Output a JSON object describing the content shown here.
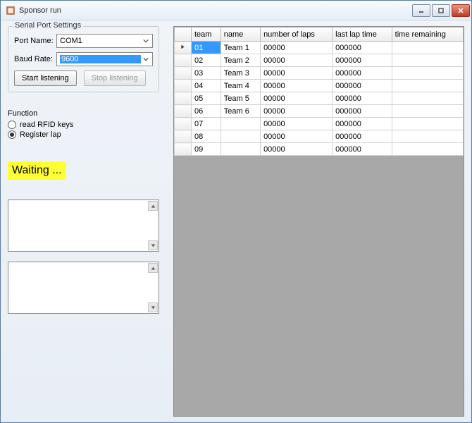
{
  "window": {
    "title": "Sponsor run"
  },
  "serial": {
    "legend": "Serial Port Settings",
    "port_label": "Port Name:",
    "port_value": "COM1",
    "baud_label": "Baud Rate:",
    "baud_value": "9600"
  },
  "buttons": {
    "start": "Start listening",
    "stop": "Stop listening"
  },
  "function": {
    "legend": "Function",
    "opt1": "read RFID keys",
    "opt2": "Register lap"
  },
  "status": "Waiting ...",
  "grid": {
    "headers": {
      "team": "team",
      "name": "name",
      "laps": "number of laps",
      "last": "last lap time",
      "remain": "time remaining"
    },
    "rows": [
      {
        "team": "01",
        "name": "Team 1",
        "laps": "00000",
        "last": "000000",
        "remain": ""
      },
      {
        "team": "02",
        "name": "Team 2",
        "laps": "00000",
        "last": "000000",
        "remain": ""
      },
      {
        "team": "03",
        "name": "Team 3",
        "laps": "00000",
        "last": "000000",
        "remain": ""
      },
      {
        "team": "04",
        "name": "Team 4",
        "laps": "00000",
        "last": "000000",
        "remain": ""
      },
      {
        "team": "05",
        "name": "Team 5",
        "laps": "00000",
        "last": "000000",
        "remain": ""
      },
      {
        "team": "06",
        "name": "Team 6",
        "laps": "00000",
        "last": "000000",
        "remain": ""
      },
      {
        "team": "07",
        "name": "",
        "laps": "00000",
        "last": "000000",
        "remain": ""
      },
      {
        "team": "08",
        "name": "",
        "laps": "00000",
        "last": "000000",
        "remain": ""
      },
      {
        "team": "09",
        "name": "",
        "laps": "00000",
        "last": "000000",
        "remain": ""
      }
    ]
  }
}
